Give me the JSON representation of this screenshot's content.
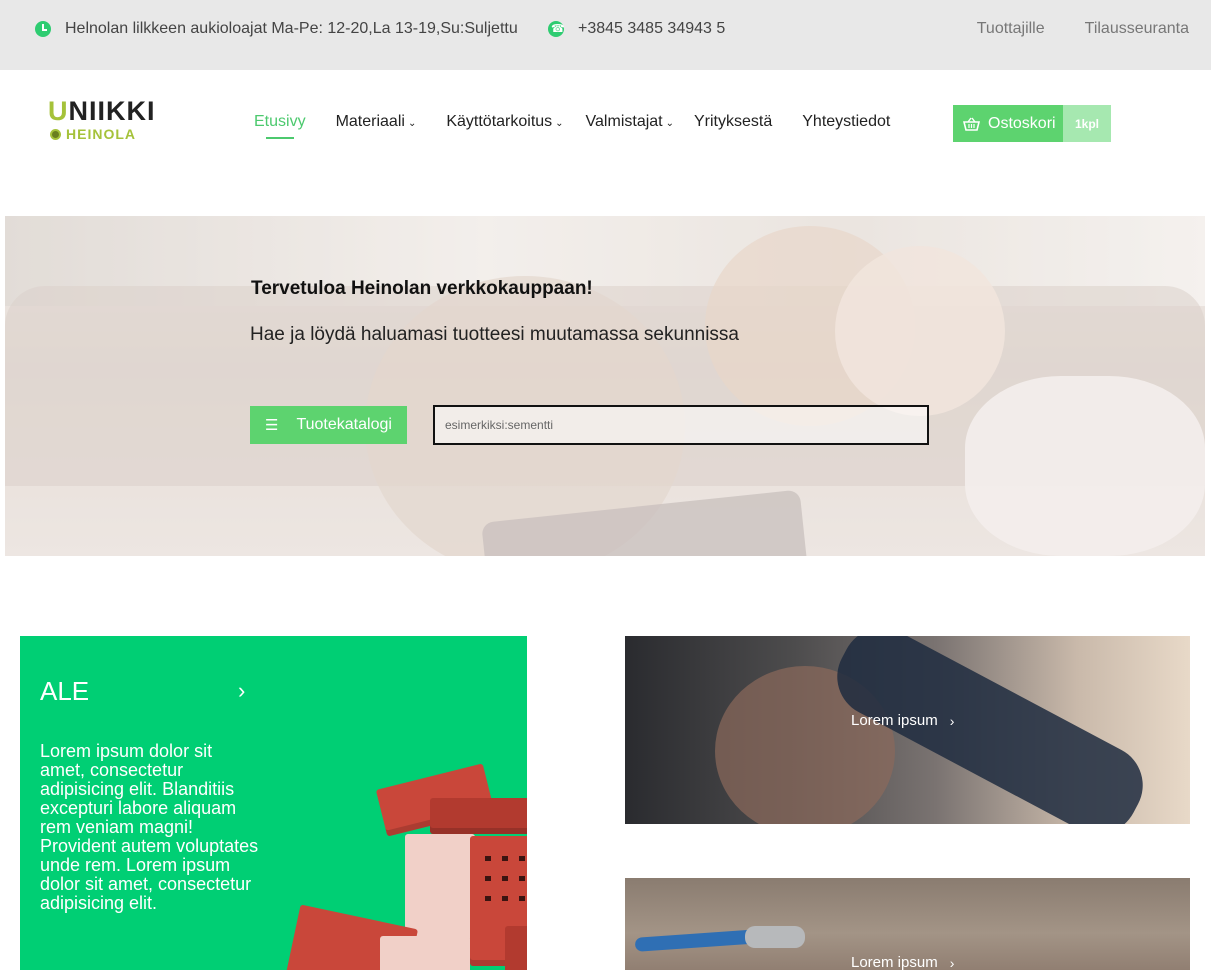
{
  "topbar": {
    "hours_icon": "clock-icon",
    "hours_text": "Helnolan lilkkeen aukioloajat Ma-Pe: 12-20,La 13-19,Su:Suljettu",
    "phone_icon": "phone-icon",
    "phone_text": "+3845 3485 34943 5",
    "links": [
      "Tuottajille",
      "Tilausseuranta"
    ]
  },
  "logo": {
    "line1_first": "U",
    "line1_rest": "NIIKKI",
    "line2": "HEINOLA"
  },
  "nav": {
    "items": [
      {
        "label": "Etusivy",
        "active": true,
        "dropdown": false
      },
      {
        "label": "Materiaali",
        "active": false,
        "dropdown": true
      },
      {
        "label": "Käyttötarkoitus",
        "active": false,
        "dropdown": true
      },
      {
        "label": "Valmistajat",
        "active": false,
        "dropdown": true
      },
      {
        "label": "Yrityksestä",
        "active": false,
        "dropdown": false
      },
      {
        "label": "Yhteystiedot",
        "active": false,
        "dropdown": false
      }
    ],
    "chevron": "⌄"
  },
  "cart": {
    "icon": "basket-icon",
    "label": "Ostoskori",
    "count": "1kpl"
  },
  "hero": {
    "title": "Tervetuloa Heinolan verkkokauppaan!",
    "subtitle": "Hae ja löydä haluamasi tuotteesi muutamassa sekunnissa",
    "catalog_icon": "☰",
    "catalog_label": "Tuotekatalogi",
    "search_placeholder": "esimerkiksi:sementti"
  },
  "sale": {
    "title": "ALE",
    "arrow": "›",
    "text": "Lorem ipsum dolor sit amet, consectetur adipisicing elit. Blanditiis excepturi labore aliquam rem veniam magni! Provident autem voluptates unde rem. Lorem ipsum dolor sit amet, consectetur adipisicing elit."
  },
  "tiles": [
    {
      "label": "Lorem ipsum",
      "chevron": "›"
    },
    {
      "label": "Lorem ipsum",
      "chevron": "›"
    }
  ],
  "colors": {
    "accent": "#5dd36f",
    "sale_bg": "#00cf74",
    "logo_green": "#a5c23a",
    "topbar_bg": "#e8e8e8"
  }
}
